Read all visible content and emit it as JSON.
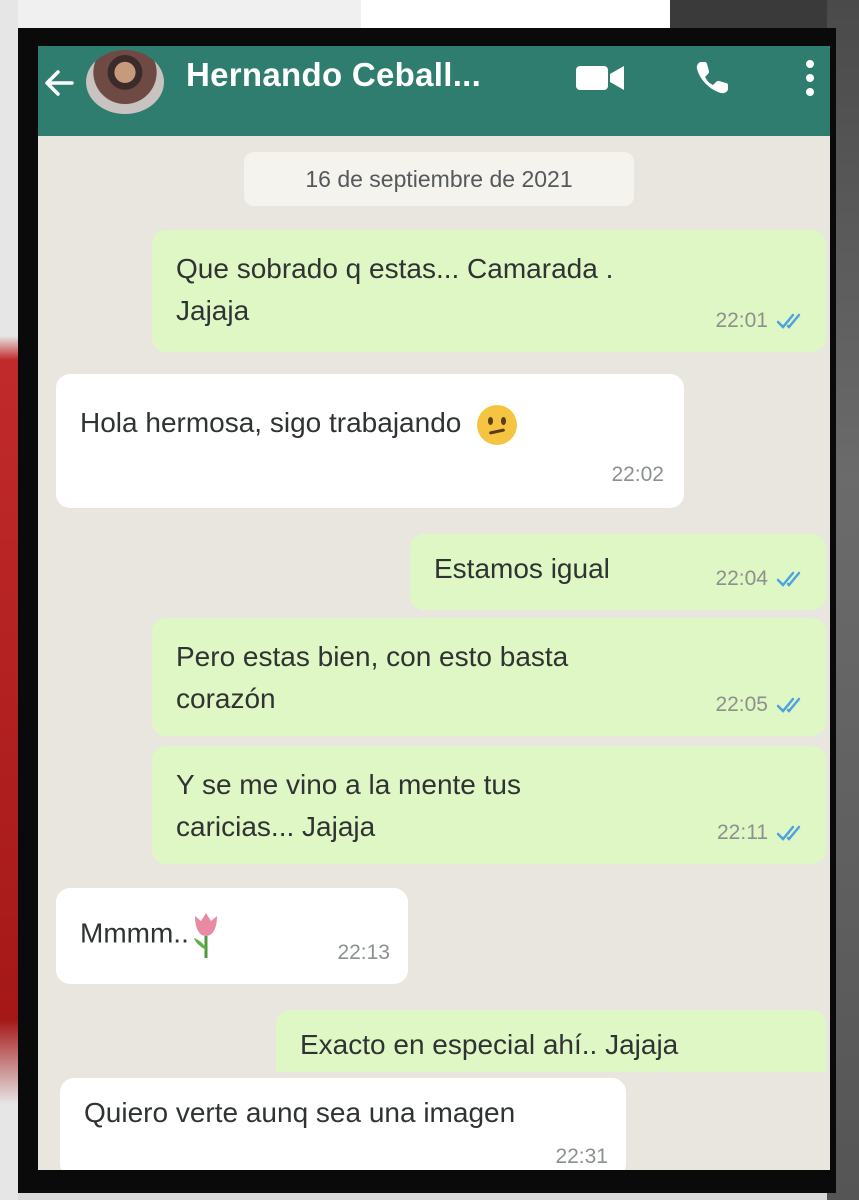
{
  "chat": {
    "contact_name": "Hernando Ceball...",
    "date_separator": "16 de septiembre de 2021"
  },
  "icons": {
    "back": "arrow-left-icon",
    "video": "video-camera-icon",
    "call": "phone-icon",
    "menu": "more-vertical-icon",
    "read_receipt": "double-check-icon"
  },
  "colors": {
    "header": "#2e7d6e",
    "outgoing_bubble": "#dff7c4",
    "incoming_bubble": "#ffffff",
    "read_tick": "#4fa3e0"
  },
  "messages": [
    {
      "direction": "outgoing",
      "text": "Que sobrado q estas... Camarada .\nJajaja",
      "time": "22:01",
      "read": true
    },
    {
      "direction": "incoming",
      "text": "Hola hermosa, sigo trabajando",
      "emoji": "confused-face",
      "time": "22:02"
    },
    {
      "direction": "outgoing",
      "text": "Estamos igual",
      "time": "22:04",
      "read": true
    },
    {
      "direction": "outgoing",
      "text": "Pero estas bien, con esto basta\ncorazón",
      "time": "22:05",
      "read": true
    },
    {
      "direction": "outgoing",
      "text": "Y se me vino a la mente tus\ncaricias... Jajaja",
      "time": "22:11",
      "read": true
    },
    {
      "direction": "incoming",
      "text": "Mmmm..",
      "emoji": "tulip",
      "time": "22:13"
    },
    {
      "direction": "outgoing",
      "text": "Exacto en especial ahí.. Jajaja",
      "time": "",
      "read": false
    },
    {
      "direction": "incoming",
      "text": "Quiero verte aunq sea una imagen",
      "time": "22:31"
    }
  ]
}
